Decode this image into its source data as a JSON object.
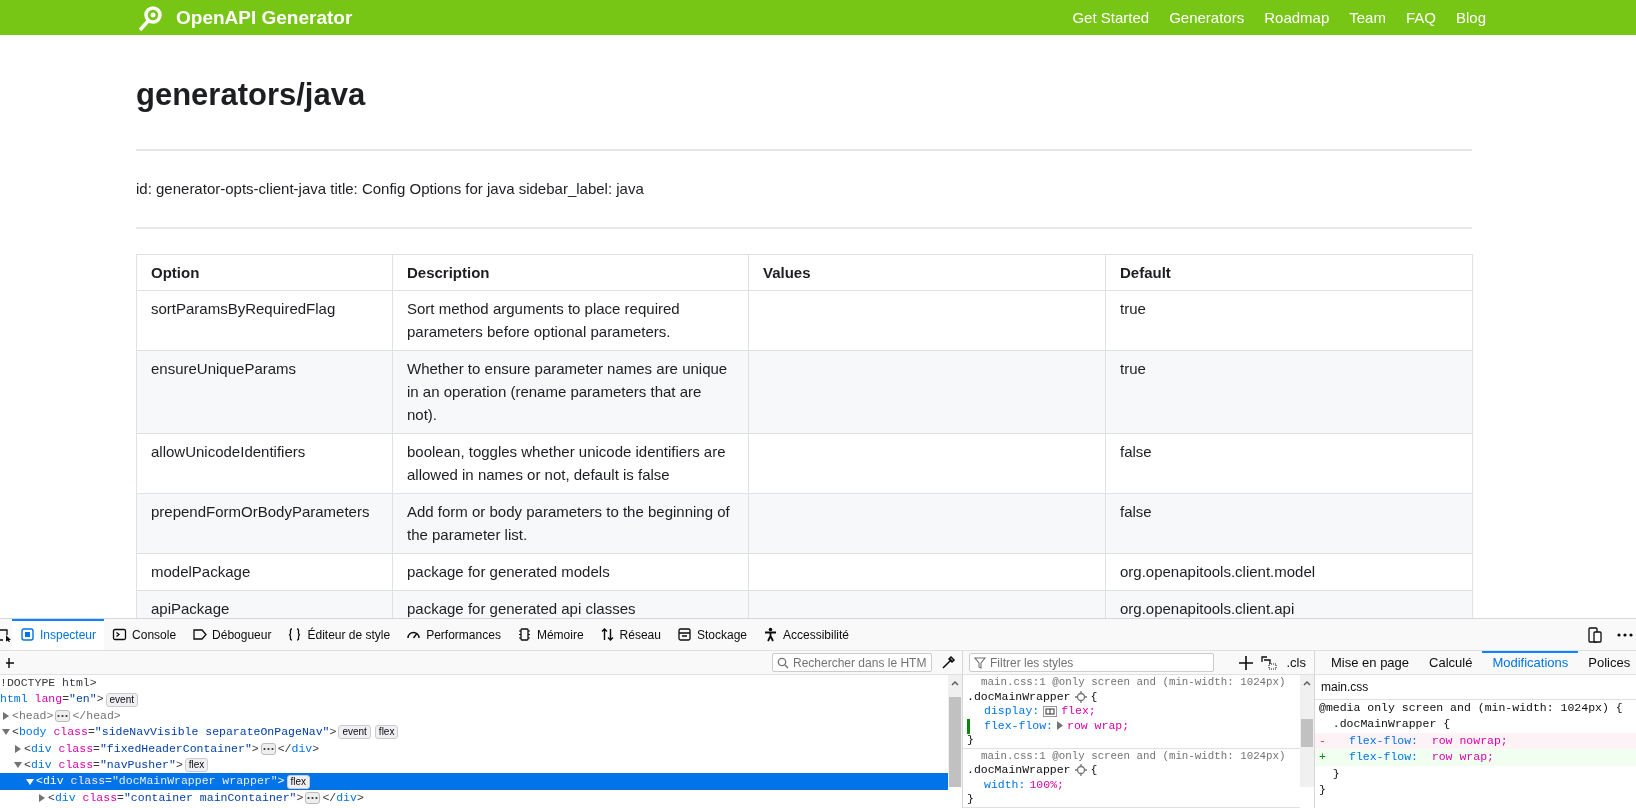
{
  "site_header": {
    "brand": "OpenAPI Generator",
    "links": [
      "Get Started",
      "Generators",
      "Roadmap",
      "Team",
      "FAQ",
      "Blog"
    ]
  },
  "doc": {
    "title": "generators/java",
    "front_matter": "id: generator-opts-client-java title: Config Options for java sidebar_label: java",
    "table": {
      "columns": [
        "Option",
        "Description",
        "Values",
        "Default"
      ],
      "rows": [
        {
          "option": "sortParamsByRequiredFlag",
          "description": "Sort method arguments to place required parameters before optional parameters.",
          "default": "true"
        },
        {
          "option": "ensureUniqueParams",
          "description": "Whether to ensure parameter names are unique in an operation (rename parameters that are not).",
          "default": "true"
        },
        {
          "option": "allowUnicodeIdentifiers",
          "description": "boolean, toggles whether unicode identifiers are allowed in names or not, default is false",
          "default": "false"
        },
        {
          "option": "prependFormOrBodyParameters",
          "description": "Add form or body parameters to the beginning of the parameter list.",
          "default": "false"
        },
        {
          "option": "modelPackage",
          "description": "package for generated models",
          "default": "org.openapitools.client.model"
        },
        {
          "option": "apiPackage",
          "description": "package for generated api classes",
          "default": "org.openapitools.client.api"
        }
      ]
    }
  },
  "devtools": {
    "tabs": [
      {
        "label": "Inspecteur",
        "kind": "inspector",
        "selected": true
      },
      {
        "label": "Console",
        "kind": "console",
        "selected": false
      },
      {
        "label": "Débogueur",
        "kind": "debugger",
        "selected": false
      },
      {
        "label": "Éditeur de style",
        "kind": "styles",
        "selected": false
      },
      {
        "label": "Performances",
        "kind": "performance",
        "selected": false
      },
      {
        "label": "Mémoire",
        "kind": "memory",
        "selected": false
      },
      {
        "label": "Réseau",
        "kind": "network",
        "selected": false
      },
      {
        "label": "Stockage",
        "kind": "storage",
        "selected": false
      },
      {
        "label": "Accessibilité",
        "kind": "accessibility",
        "selected": false
      }
    ],
    "html_search": {
      "placeholder": "Rechercher dans le HTM"
    },
    "dom_tree": [
      {
        "selected": false,
        "open": [
          {
            "kind": "punct",
            "text": "!DOCTYPE html>"
          }
        ]
      },
      {
        "selected": false,
        "open": [
          {
            "kind": "tag",
            "text": "html"
          },
          {
            "kind": "attr",
            "text": " lang"
          },
          {
            "kind": "punct",
            "text": "="
          },
          {
            "kind": "value",
            "text": "\"en\""
          },
          {
            "kind": "punct",
            "text": ">"
          }
        ],
        "badges": [
          "event"
        ],
        "children": [
          {
            "selected": false,
            "expanded": false,
            "open": [
              {
                "kind": "dim",
                "text": "<head>"
              }
            ],
            "collapsed": true,
            "close": [
              {
                "kind": "dim",
                "text": "</head>"
              }
            ]
          },
          {
            "selected": false,
            "expanded": true,
            "open": [
              {
                "kind": "punct",
                "text": "<"
              },
              {
                "kind": "tag",
                "text": "body"
              },
              {
                "kind": "attr",
                "text": " class"
              },
              {
                "kind": "punct",
                "text": "="
              },
              {
                "kind": "value",
                "text": "\"sideNavVisible separateOnPageNav\""
              },
              {
                "kind": "punct",
                "text": ">"
              }
            ],
            "badges": [
              "event",
              "flex"
            ],
            "children": [
              {
                "selected": false,
                "expanded": false,
                "open": [
                  {
                    "kind": "punct",
                    "text": "<"
                  },
                  {
                    "kind": "tag",
                    "text": "div"
                  },
                  {
                    "kind": "attr",
                    "text": " class"
                  },
                  {
                    "kind": "punct",
                    "text": "="
                  },
                  {
                    "kind": "value",
                    "text": "\"fixedHeaderContainer\""
                  },
                  {
                    "kind": "punct",
                    "text": ">"
                  }
                ],
                "collapsed": true,
                "close": [
                  {
                    "kind": "punct",
                    "text": "</"
                  },
                  {
                    "kind": "tag",
                    "text": "div"
                  },
                  {
                    "kind": "punct",
                    "text": ">"
                  }
                ]
              },
              {
                "selected": false,
                "expanded": true,
                "open": [
                  {
                    "kind": "punct",
                    "text": "<"
                  },
                  {
                    "kind": "tag",
                    "text": "div"
                  },
                  {
                    "kind": "attr",
                    "text": " class"
                  },
                  {
                    "kind": "punct",
                    "text": "="
                  },
                  {
                    "kind": "value",
                    "text": "\"navPusher\""
                  },
                  {
                    "kind": "punct",
                    "text": ">"
                  }
                ],
                "badges": [
                  "flex"
                ],
                "children": [
                  {
                    "selected": true,
                    "expanded": true,
                    "open": [
                      {
                        "kind": "punct",
                        "text": "<"
                      },
                      {
                        "kind": "tag",
                        "text": "div"
                      },
                      {
                        "kind": "attr",
                        "text": " class"
                      },
                      {
                        "kind": "punct",
                        "text": "="
                      },
                      {
                        "kind": "value",
                        "text": "\"docMainWrapper wrapper\""
                      },
                      {
                        "kind": "punct",
                        "text": ">"
                      }
                    ],
                    "badges": [
                      "flex"
                    ],
                    "children": [
                      {
                        "selected": false,
                        "expanded": false,
                        "open": [
                          {
                            "kind": "punct",
                            "text": "<"
                          },
                          {
                            "kind": "tag",
                            "text": "div"
                          },
                          {
                            "kind": "attr",
                            "text": " class"
                          },
                          {
                            "kind": "punct",
                            "text": "="
                          },
                          {
                            "kind": "value",
                            "text": "\"container mainContainer\""
                          },
                          {
                            "kind": "punct",
                            "text": ">"
                          }
                        ],
                        "collapsed": true,
                        "close": [
                          {
                            "kind": "punct",
                            "text": "</"
                          },
                          {
                            "kind": "tag",
                            "text": "div"
                          },
                          {
                            "kind": "punct",
                            "text": ">"
                          }
                        ]
                      }
                    ]
                  }
                ]
              }
            ]
          }
        ]
      }
    ],
    "styles_filter": {
      "placeholder": "Filtrer les styles"
    },
    "cls_label": ".cls",
    "rules": [
      {
        "source": "main.css:1 @only screen and (min-width: 1024px)",
        "selector": ".docMainWrapper",
        "open": "{",
        "close": "}",
        "declarations": [
          {
            "kind": "flex-swatch",
            "name": "display:",
            "value": "flex;",
            "changed": false
          },
          {
            "kind": "shorthand",
            "name": "flex-flow:",
            "value": "row wrap;",
            "changed": true
          }
        ]
      },
      {
        "source": "main.css:1 @only screen and (min-width: 1024px)",
        "selector": ".docMainWrapper",
        "open": "{",
        "close": "}",
        "declarations": [
          {
            "kind": "plain",
            "name": "width:",
            "value": "100%;",
            "changed": false
          }
        ]
      }
    ],
    "side_tabs": [
      {
        "label": "Mise en page",
        "selected": false
      },
      {
        "label": "Calculé",
        "selected": false
      },
      {
        "label": "Modifications",
        "selected": true
      },
      {
        "label": "Polices",
        "selected": false
      }
    ],
    "changes": {
      "file": "main.css",
      "lines": [
        {
          "kind": "context",
          "text": "@media only screen and (min-width: 1024px) {"
        },
        {
          "kind": "context",
          "text": "  .docMainWrapper {"
        },
        {
          "kind": "removed",
          "sign": "-",
          "property": "flex-flow:",
          "value": "row nowrap;"
        },
        {
          "kind": "added",
          "sign": "+",
          "property": "flex-flow:",
          "value": "row wrap;"
        },
        {
          "kind": "context",
          "text": "  }"
        },
        {
          "kind": "context",
          "text": "}"
        }
      ]
    }
  }
}
